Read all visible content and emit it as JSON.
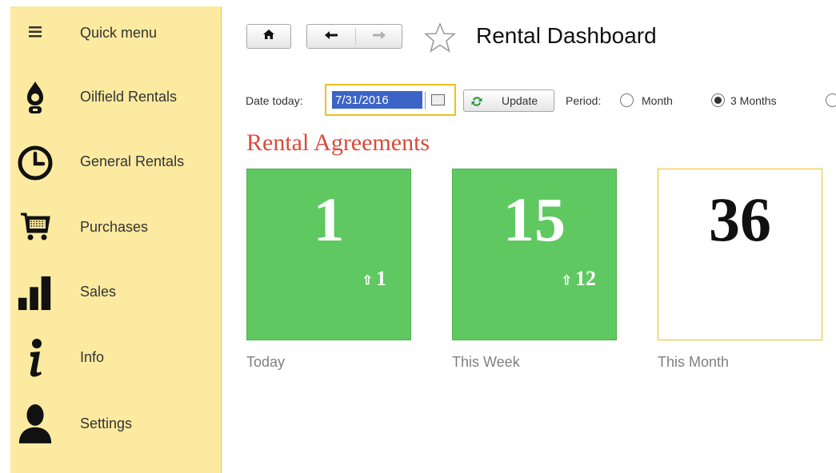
{
  "sidebar": {
    "items": [
      {
        "label": "Quick menu",
        "icon": "hamburger-icon"
      },
      {
        "label": "Oilfield Rentals",
        "icon": "oil-drop-icon"
      },
      {
        "label": "General Rentals",
        "icon": "clock-icon"
      },
      {
        "label": "Purchases",
        "icon": "cart-icon"
      },
      {
        "label": "Sales",
        "icon": "bar-chart-icon"
      },
      {
        "label": "Info",
        "icon": "info-icon"
      },
      {
        "label": "Settings",
        "icon": "user-icon"
      }
    ]
  },
  "toolbar": {
    "title": "Rental Dashboard",
    "home_icon": "home-icon",
    "back_icon": "arrow-left-icon",
    "forward_icon": "arrow-right-icon",
    "favorite_icon": "star-icon"
  },
  "filters": {
    "date_label": "Date today:",
    "date_value": "7/31/2016",
    "update_label": "Update",
    "period_label": "Period:",
    "periods": [
      {
        "label": "Month",
        "checked": false
      },
      {
        "label": "3 Months",
        "checked": true
      }
    ]
  },
  "section": {
    "title": "Rental Agreements"
  },
  "tiles": [
    {
      "value": "1",
      "delta": "1",
      "caption": "Today",
      "style": "green"
    },
    {
      "value": "15",
      "delta": "12",
      "caption": "This Week",
      "style": "green"
    },
    {
      "value": "36",
      "delta": "",
      "caption": "This Month",
      "style": "white"
    }
  ],
  "colors": {
    "sidebar_bg": "#fbeaa0",
    "tile_green": "#5fc861",
    "title_red": "#d94a3a",
    "highlight_yellow": "#f0c020"
  }
}
